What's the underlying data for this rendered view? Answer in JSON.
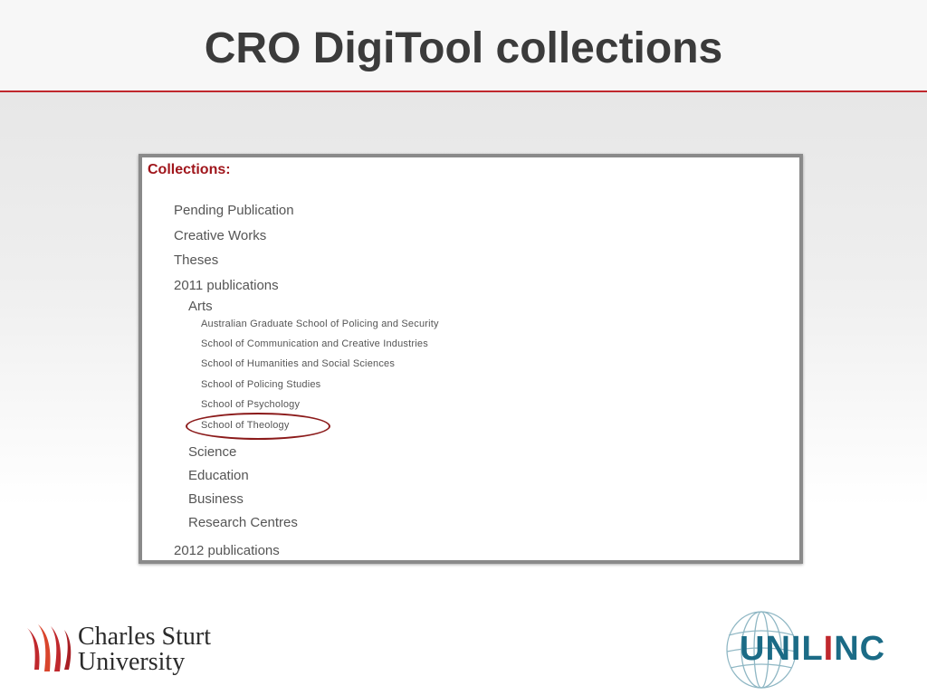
{
  "slide": {
    "title": "CRO DigiTool collections"
  },
  "collections": {
    "heading": "Collections:",
    "items": {
      "pending": "Pending Publication",
      "creative": "Creative Works",
      "theses": "Theses",
      "pubs2011": "2011 publications",
      "arts": "Arts",
      "agsps": "Australian Graduate School of Policing and Security",
      "scci": "School of Communication and Creative Industries",
      "shss": "School of Humanities and Social Sciences",
      "sps": "School of Policing Studies",
      "spsych": "School of Psychology",
      "stheo": "School of Theology",
      "science": "Science",
      "education": "Education",
      "business": "Business",
      "research": "Research Centres",
      "pubs2012": "2012 publications"
    },
    "highlighted_item": "School of Theology"
  },
  "logos": {
    "csu_line1": "Charles Sturt",
    "csu_line2": "University",
    "unilinc_pre": "UNIL",
    "unilinc_accent": "I",
    "unilinc_post": "NC"
  },
  "colors": {
    "accent_red": "#c0282d",
    "heading_red": "#a0161c",
    "unilinc_teal": "#1b6b86"
  }
}
